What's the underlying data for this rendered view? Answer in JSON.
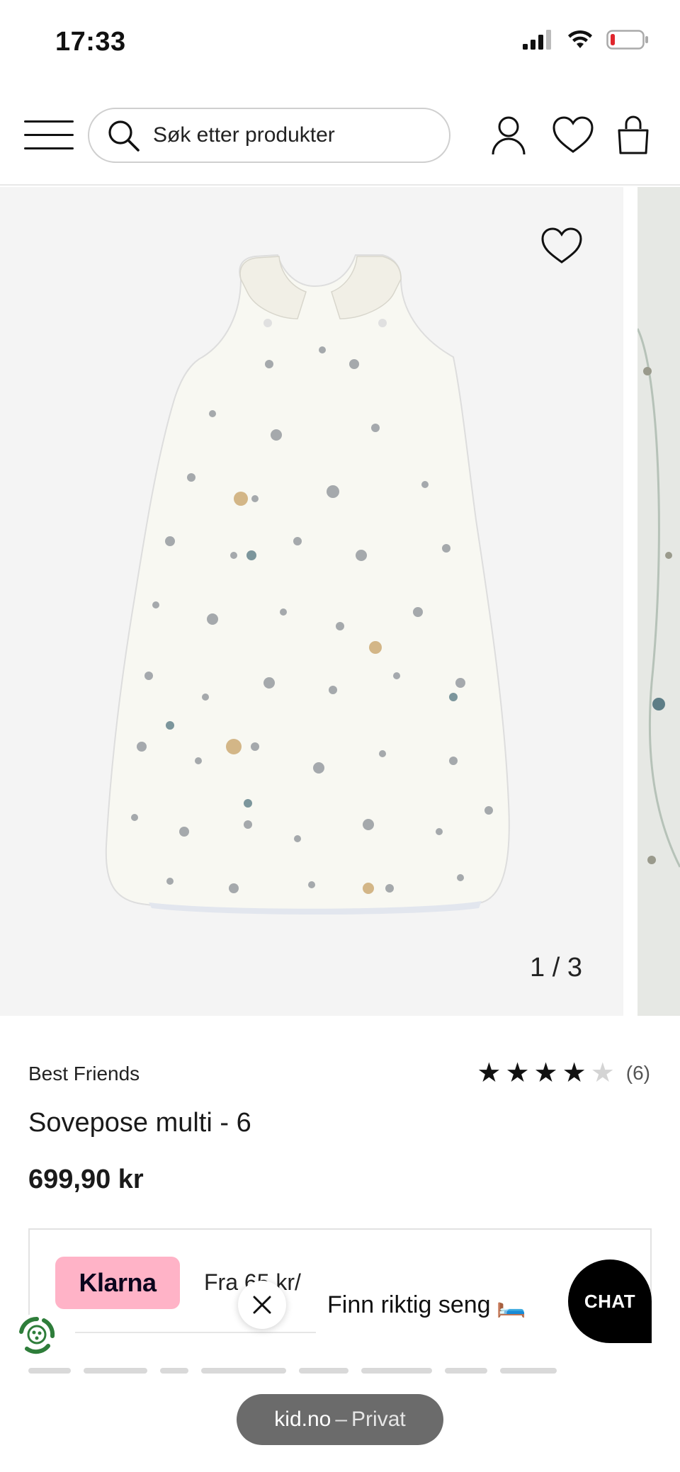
{
  "status_bar": {
    "time": "17:33"
  },
  "header": {
    "search_placeholder": "Søk etter produkter"
  },
  "gallery": {
    "counter": "1 / 3"
  },
  "product": {
    "brand": "Best Friends",
    "title": "Sovepose multi - 6",
    "price": "699,90 kr",
    "rating": {
      "stars_filled": 4,
      "stars_total": 5,
      "count": "(6)"
    }
  },
  "klarna": {
    "logo": "Klarna",
    "text": "Fra 65 kr/"
  },
  "promo": {
    "text": "Finn riktig seng",
    "emoji": "🛏️"
  },
  "chat": {
    "label": "CHAT"
  },
  "browser": {
    "domain": "kid.no",
    "separator": "–",
    "mode": "Privat"
  },
  "colors": {
    "klarna_pink": "#ffb3c7",
    "chat_bg": "#000000",
    "url_pill_bg": "#6b6b6b",
    "eco_green": "#2e7d3a"
  }
}
